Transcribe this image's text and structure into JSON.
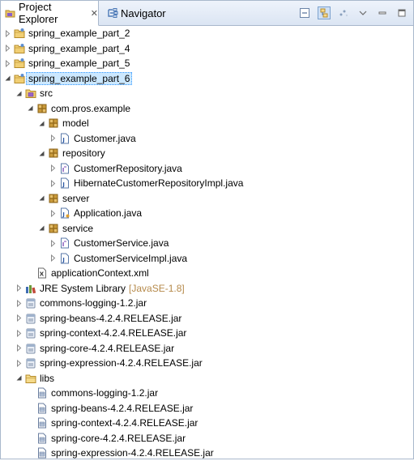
{
  "tabs": [
    {
      "label": "Project Explorer",
      "close": "✕",
      "icon": "package-explorer-icon",
      "active": true
    },
    {
      "label": "Navigator",
      "icon": "navigator-icon",
      "active": false
    }
  ],
  "view_actions": [
    "collapse-all-icon",
    "link-with-editor-icon",
    "view-menu-icon",
    "view-menu-chevron-icon",
    "minimize-icon",
    "maximize-icon"
  ],
  "tree": [
    {
      "depth": 0,
      "toggle": "closed",
      "icon": "project-icon",
      "label": "spring_example_part_2"
    },
    {
      "depth": 0,
      "toggle": "closed",
      "icon": "project-icon",
      "label": "spring_example_part_4"
    },
    {
      "depth": 0,
      "toggle": "closed",
      "icon": "project-icon",
      "label": "spring_example_part_5"
    },
    {
      "depth": 0,
      "toggle": "open",
      "icon": "project-icon",
      "label": "spring_example_part_6",
      "selected": true
    },
    {
      "depth": 1,
      "toggle": "open",
      "icon": "source-folder-icon",
      "label": "src"
    },
    {
      "depth": 2,
      "toggle": "open",
      "icon": "package-icon",
      "label": "com.pros.example"
    },
    {
      "depth": 3,
      "toggle": "open",
      "icon": "package-icon",
      "label": "model"
    },
    {
      "depth": 4,
      "toggle": "closed",
      "icon": "java-file-icon",
      "label": "Customer.java"
    },
    {
      "depth": 3,
      "toggle": "open",
      "icon": "package-icon",
      "label": "repository"
    },
    {
      "depth": 4,
      "toggle": "closed",
      "icon": "java-interface-icon",
      "label": "CustomerRepository.java"
    },
    {
      "depth": 4,
      "toggle": "closed",
      "icon": "java-file-icon",
      "label": "HibernateCustomerRepositoryImpl.java"
    },
    {
      "depth": 3,
      "toggle": "open",
      "icon": "package-icon",
      "label": "server"
    },
    {
      "depth": 4,
      "toggle": "closed",
      "icon": "java-main-icon",
      "label": "Application.java"
    },
    {
      "depth": 3,
      "toggle": "open",
      "icon": "package-icon",
      "label": "service"
    },
    {
      "depth": 4,
      "toggle": "closed",
      "icon": "java-interface-icon",
      "label": "CustomerService.java"
    },
    {
      "depth": 4,
      "toggle": "closed",
      "icon": "java-file-icon",
      "label": "CustomerServiceImpl.java"
    },
    {
      "depth": 2,
      "toggle": "none",
      "icon": "xml-file-icon",
      "label": "applicationContext.xml"
    },
    {
      "depth": 1,
      "toggle": "closed",
      "icon": "library-icon",
      "label": "JRE System Library",
      "decoration": "[JavaSE-1.8]"
    },
    {
      "depth": 1,
      "toggle": "closed",
      "icon": "jar-icon",
      "label": "commons-logging-1.2.jar"
    },
    {
      "depth": 1,
      "toggle": "closed",
      "icon": "jar-icon",
      "label": "spring-beans-4.2.4.RELEASE.jar"
    },
    {
      "depth": 1,
      "toggle": "closed",
      "icon": "jar-icon",
      "label": "spring-context-4.2.4.RELEASE.jar"
    },
    {
      "depth": 1,
      "toggle": "closed",
      "icon": "jar-icon",
      "label": "spring-core-4.2.4.RELEASE.jar"
    },
    {
      "depth": 1,
      "toggle": "closed",
      "icon": "jar-icon",
      "label": "spring-expression-4.2.4.RELEASE.jar"
    },
    {
      "depth": 1,
      "toggle": "open",
      "icon": "folder-icon",
      "label": "libs"
    },
    {
      "depth": 2,
      "toggle": "none",
      "icon": "jar-file-icon",
      "label": "commons-logging-1.2.jar"
    },
    {
      "depth": 2,
      "toggle": "none",
      "icon": "jar-file-icon",
      "label": "spring-beans-4.2.4.RELEASE.jar"
    },
    {
      "depth": 2,
      "toggle": "none",
      "icon": "jar-file-icon",
      "label": "spring-context-4.2.4.RELEASE.jar"
    },
    {
      "depth": 2,
      "toggle": "none",
      "icon": "jar-file-icon",
      "label": "spring-core-4.2.4.RELEASE.jar"
    },
    {
      "depth": 2,
      "toggle": "none",
      "icon": "jar-file-icon",
      "label": "spring-expression-4.2.4.RELEASE.jar"
    }
  ],
  "colors": {
    "selection_bg": "#cce8ff",
    "decoration": "#b5894a",
    "tabbar_bg": "#dbe5f3",
    "border": "#a9b8cc"
  }
}
